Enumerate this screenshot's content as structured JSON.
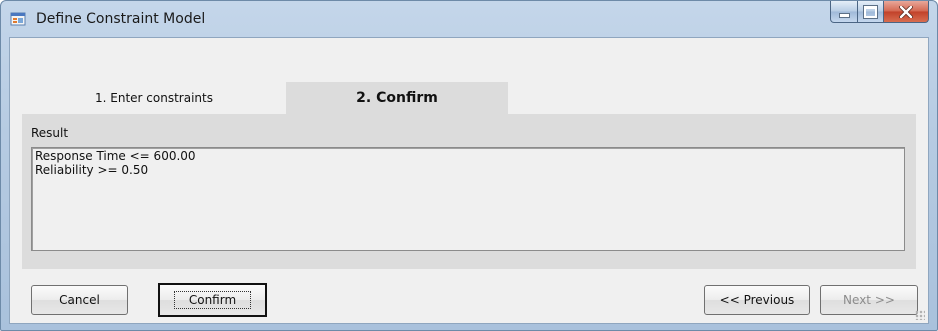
{
  "window": {
    "title": "Define Constraint Model",
    "icons": {
      "app": "form-icon",
      "minimize": "minimize-icon",
      "maximize": "maximize-icon",
      "close": "close-icon"
    }
  },
  "tabs": [
    {
      "label": "1. Enter constraints",
      "selected": false
    },
    {
      "label": "2. Confirm",
      "selected": true
    }
  ],
  "result": {
    "label": "Result",
    "lines": [
      "Response Time <= 600.00",
      "Reliability >= 0.50"
    ]
  },
  "buttons": {
    "cancel": "Cancel",
    "confirm": "Confirm",
    "previous": "<< Previous",
    "next": "Next >>"
  }
}
